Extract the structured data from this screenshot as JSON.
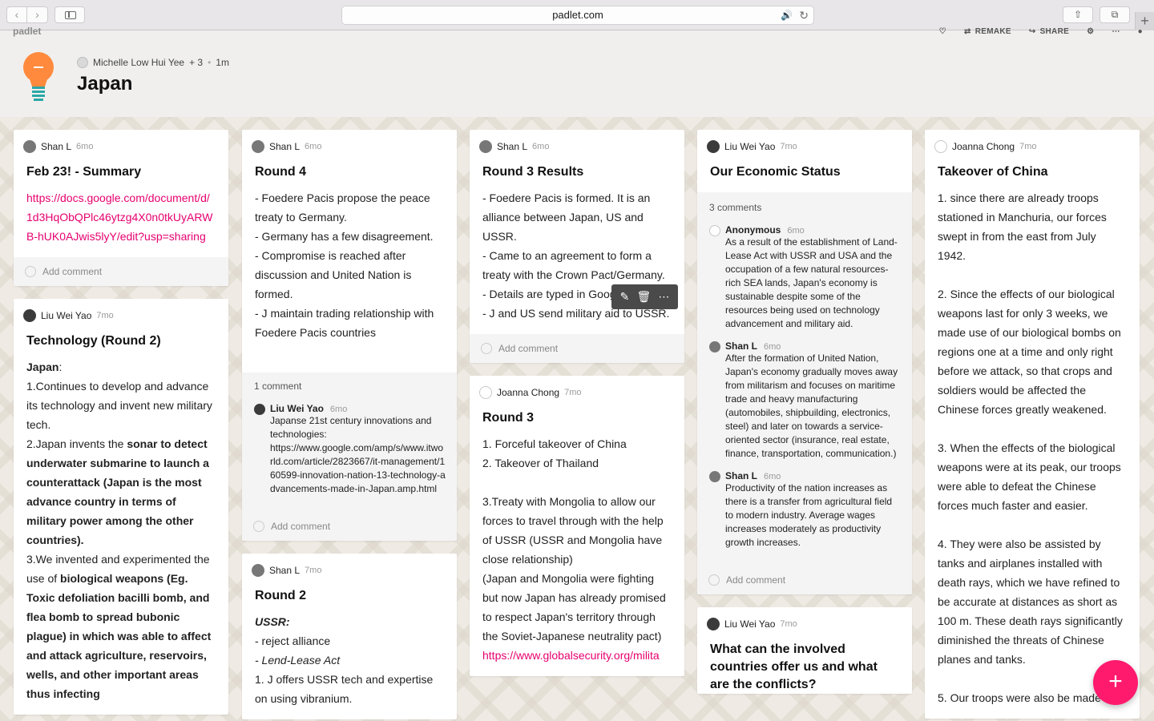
{
  "browser": {
    "url": "padlet.com",
    "back": "‹",
    "forward": "›",
    "share": "⇧",
    "tabs": "⧉",
    "new_tab": "+"
  },
  "padlet": {
    "logo": "padlet",
    "toolbar": {
      "remake": "REMAKE",
      "share": "SHARE"
    },
    "authors": "Michelle Low Hui Yee",
    "authors_more": "+ 3",
    "updated": "1m",
    "title": "Japan"
  },
  "columns": [
    {
      "cards": [
        {
          "author": "Shan L",
          "ago": "6mo",
          "title": "Feb 23! - Summary",
          "link": "https://docs.google.com/document/d/1d3HqObQPlc46ytzg4X0n0tkUyARWB-hUK0AJwis5lyY/edit?usp=sharing",
          "add_comment": "Add comment"
        },
        {
          "author": "Liu Wei Yao",
          "ago": "7mo",
          "title": "Technology (Round 2)",
          "b1": "Japan",
          "b2": ":",
          "b3": "1.Continues to develop and advance its technology and invent new military tech.",
          "b4a": "2.Japan invents the ",
          "b4b": "sonar to detect underwater submarine to launch a counterattack (Japan is the most advance country in terms of military power among the other countries).",
          "b5a": "3.We invented and experimented the use of ",
          "b5b": "biological weapons (Eg. Toxic defoliation bacilli bomb, and flea bomb to spread bubonic plague) in which was able to affect and attack agriculture, reservoirs, wells, and other important areas thus infecting"
        }
      ]
    },
    {
      "cards": [
        {
          "author": "Shan L",
          "ago": "6mo",
          "title": "Round 4",
          "l1": "- Foedere Pacis propose the peace treaty to Germany.",
          "l2": "- Germany has a few disagreement.",
          "l3": "- Compromise is reached after discussion and United Nation is formed.",
          "l4": "- J maintain trading relationship with Foedere Pacis countries",
          "comment_count": "1 comment",
          "c_author": "Liu Wei Yao",
          "c_ago": "6mo",
          "c_text": "Japanse 21st century innovations and technologies:",
          "c_link": "https://www.google.com/amp/s/www.itworld.com/article/2823667/it-management/160599-innovation-nation-13-technology-advancements-made-in-Japan.amp.html",
          "add_comment": "Add comment"
        },
        {
          "author": "Shan L",
          "ago": "7mo",
          "title": "Round 2",
          "l1": "USSR:",
          "l2": "- reject alliance",
          "l3": "- Lend-Lease Act",
          "l4": "1. J offers USSR tech and expertise on using vibranium."
        }
      ]
    },
    {
      "cards": [
        {
          "author": "Shan L",
          "ago": "6mo",
          "title": "Round 3 Results",
          "l1": "- Foedere Pacis is formed. It is an alliance between Japan, US and USSR.",
          "l2": "- Came to an agreement to form a treaty with the Crown Pact/Germany.",
          "l3": "- Details are typed in Google Doc.",
          "l4": "- J and US send military aid to USSR.",
          "add_comment": "Add comment"
        },
        {
          "author": "Joanna Chong",
          "ago": "7mo",
          "title": "Round 3",
          "l1": "1. Forceful takeover of China",
          "l2": "2. Takeover of Thailand",
          "l3": "3.Treaty with Mongolia to allow our forces to travel through with the help of USSR (USSR and Mongolia have close relationship)",
          "l4": "(Japan and Mongolia were fighting but now Japan has already promised to respect Japan's territory through the Soviet-Japanese neutrality pact)",
          "link": "https://www.globalsecurity.org/milita"
        }
      ]
    },
    {
      "cards": [
        {
          "author": "Liu Wei Yao",
          "ago": "7mo",
          "title": "Our Economic Status",
          "comment_count": "3 comments",
          "c1_author": "Anonymous",
          "c1_ago": "6mo",
          "c1_text": "As a result of the establishment of Land-Lease Act with USSR and USA and the occupation of a few natural resources-rich SEA lands, Japan's economy is sustainable despite some of the resources being used on technology advancement and military aid.",
          "c2_author": "Shan L",
          "c2_ago": "6mo",
          "c2_text": "After the formation of United Nation, Japan's economy gradually moves away from militarism and focuses on maritime trade and heavy manufacturing (automobiles, shipbuilding, electronics, steel) and later on towards a service-oriented sector (insurance, real estate, finance, transportation, communication.)",
          "c3_author": "Shan L",
          "c3_ago": "6mo",
          "c3_text": "Productivity of the nation increases as there is a transfer from agricultural field to modern industry. Average wages increases moderately as productivity growth increases.",
          "add_comment": "Add comment"
        },
        {
          "author": "Liu Wei Yao",
          "ago": "7mo",
          "title": "What can the involved countries offer us and what are the conflicts?"
        }
      ]
    },
    {
      "cards": [
        {
          "author": "Joanna Chong",
          "ago": "7mo",
          "title": "Takeover of China",
          "p1": "1. since there are already troops stationed in Manchuria, our forces swept in from the east from July 1942.",
          "p2": "2. Since the effects of our biological weapons last for only 3 weeks, we made use of our biological bombs on regions one at a time and only right before we attack, so that crops and soldiers would be affected the Chinese forces greatly weakened.",
          "p3": "3. When the effects of the biological weapons were at its peak, our troops were able to defeat the Chinese forces much faster and easier.",
          "p4": "4. They were also be assisted by tanks and airplanes installed with death rays, which we have refined to be accurate at distances as short as 100 m. These death rays significantly diminished the threats of Chinese planes and tanks.",
          "p5": "5. Our troops were also be made up"
        }
      ]
    }
  ],
  "fab": "+",
  "post_tools": {
    "edit": "✎",
    "delete": "🗑",
    "more": "⋯"
  },
  "colors": {
    "accent": "#ff1a6e",
    "link": "#e6006f"
  }
}
